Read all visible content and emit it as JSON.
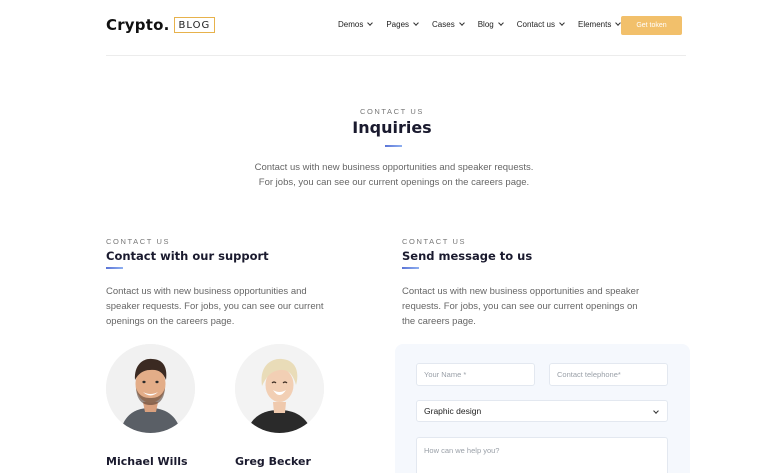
{
  "header": {
    "logo_text": "Crypto.",
    "logo_badge": "BLOG",
    "nav": [
      {
        "label": "Demos"
      },
      {
        "label": "Pages"
      },
      {
        "label": "Cases"
      },
      {
        "label": "Blog"
      },
      {
        "label": "Contact us"
      },
      {
        "label": "Elements"
      }
    ],
    "cta_label": "Get token"
  },
  "hero": {
    "eyebrow": "CONTACT US",
    "title": "Inquiries",
    "description": "Contact us with new business opportunities and speaker requests. For jobs, you can see our current openings on the careers page."
  },
  "support": {
    "eyebrow": "CONTACT US",
    "title": "Contact with our support",
    "description": "Contact us with new business opportunities and speaker requests.  For jobs, you can see our current openings on the careers page.",
    "people": [
      {
        "name": "Michael Wills"
      },
      {
        "name": "Greg Becker"
      }
    ]
  },
  "message": {
    "eyebrow": "CONTACT US",
    "title": "Send message to us",
    "description": "Contact us with new business opportunities and speaker requests.  For jobs, you can see our current openings on the careers page.",
    "form": {
      "name_placeholder": "Your Name *",
      "phone_placeholder": "Contact telephone*",
      "topic_selected": "Graphic design",
      "message_placeholder": "How can we help you?"
    }
  },
  "colors": {
    "accent": "#f2c06b",
    "logo_border": "#e7b24c",
    "divider_gradient_start": "#5b74d6",
    "form_panel": "#f5f8fd"
  }
}
